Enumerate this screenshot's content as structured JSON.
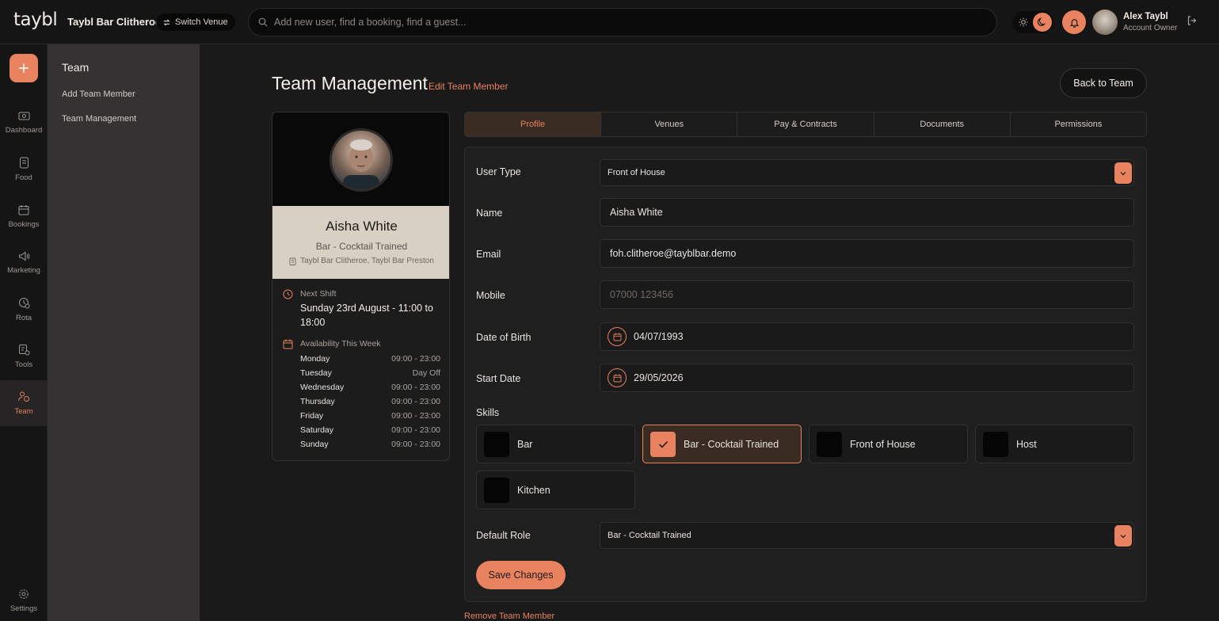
{
  "header": {
    "logo": "taybl",
    "venue_name": "Taybl Bar Clitheroe",
    "switch_venue_label": "Switch Venue",
    "search_placeholder": "Add new user, find a booking, find a guest...",
    "user_name": "Alex Taybl",
    "user_role": "Account Owner"
  },
  "rail": {
    "items": [
      {
        "label": "Dashboard",
        "icon": "dashboard-icon"
      },
      {
        "label": "Food",
        "icon": "food-icon"
      },
      {
        "label": "Bookings",
        "icon": "bookings-icon"
      },
      {
        "label": "Marketing",
        "icon": "marketing-icon"
      },
      {
        "label": "Rota",
        "icon": "rota-icon"
      },
      {
        "label": "Tools",
        "icon": "tools-icon"
      },
      {
        "label": "Team",
        "icon": "team-icon",
        "active": true
      }
    ],
    "settings_label": "Settings"
  },
  "subnav": {
    "title": "Team",
    "links": [
      "Add Team Member",
      "Team Management"
    ]
  },
  "page": {
    "title": "Team Management",
    "subtitle": "Edit Team Member",
    "back_button": "Back to Team"
  },
  "profile_card": {
    "name": "Aisha White",
    "role": "Bar - Cocktail Trained",
    "venues": "Taybl Bar Clitheroe, Taybl Bar Preston",
    "next_shift_label": "Next Shift",
    "next_shift_value": "Sunday 23rd August - 11:00 to 18:00",
    "availability_label": "Availability This Week",
    "availability": [
      {
        "day": "Monday",
        "time": "09:00 - 23:00"
      },
      {
        "day": "Tuesday",
        "time": "Day Off"
      },
      {
        "day": "Wednesday",
        "time": "09:00 - 23:00"
      },
      {
        "day": "Thursday",
        "time": "09:00 - 23:00"
      },
      {
        "day": "Friday",
        "time": "09:00 - 23:00"
      },
      {
        "day": "Saturday",
        "time": "09:00 - 23:00"
      },
      {
        "day": "Sunday",
        "time": "09:00 - 23:00"
      }
    ]
  },
  "tabs": [
    {
      "label": "Profile",
      "active": true
    },
    {
      "label": "Venues"
    },
    {
      "label": "Pay & Contracts"
    },
    {
      "label": "Documents"
    },
    {
      "label": "Permissions"
    }
  ],
  "form": {
    "user_type_label": "User Type",
    "user_type_value": "Front of House",
    "name_label": "Name",
    "name_value": "Aisha White",
    "email_label": "Email",
    "email_value": "foh.clitheroe@tayblbar.demo",
    "mobile_label": "Mobile",
    "mobile_placeholder": "07000 123456",
    "dob_label": "Date of Birth",
    "dob_value": "04/07/1993",
    "start_date_label": "Start Date",
    "start_date_value": "29/05/2026",
    "skills_label": "Skills",
    "skills": [
      {
        "label": "Bar",
        "checked": false
      },
      {
        "label": "Bar - Cocktail Trained",
        "checked": true
      },
      {
        "label": "Front of House",
        "checked": false
      },
      {
        "label": "Host",
        "checked": false
      },
      {
        "label": "Kitchen",
        "checked": false
      }
    ],
    "default_role_label": "Default Role",
    "default_role_value": "Bar - Cocktail Trained",
    "save_label": "Save Changes",
    "remove_label": "Remove Team Member"
  },
  "colors": {
    "accent": "#e8825f",
    "background": "#1b1a1a",
    "sidebar": "#353234"
  }
}
